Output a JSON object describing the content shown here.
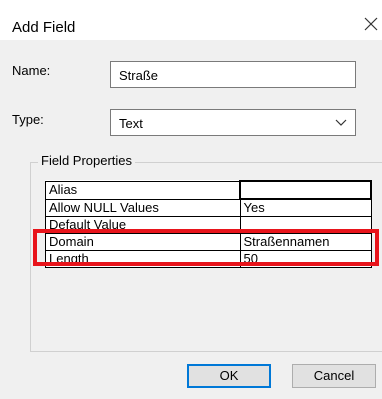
{
  "window": {
    "title": "Add Field"
  },
  "form": {
    "name_label": "Name:",
    "name_value": "Straße",
    "type_label": "Type:",
    "type_value": "Text"
  },
  "field_properties": {
    "title": "Field Properties",
    "rows": [
      {
        "property": "Alias",
        "value": ""
      },
      {
        "property": "Allow NULL Values",
        "value": "Yes"
      },
      {
        "property": "Default Value",
        "value": ""
      },
      {
        "property": "Domain",
        "value": "Straßennamen"
      },
      {
        "property": "Length",
        "value": "50"
      }
    ]
  },
  "buttons": {
    "ok": "OK",
    "cancel": "Cancel"
  },
  "annotation": {
    "highlight_color": "#e8141b"
  }
}
